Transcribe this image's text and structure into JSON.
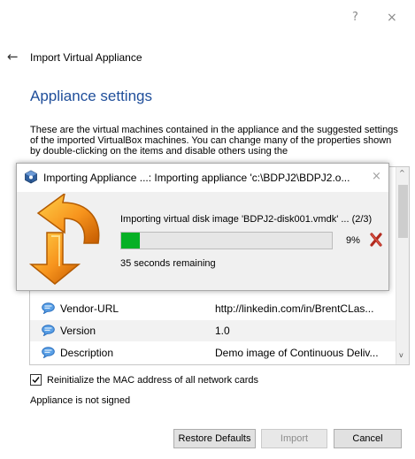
{
  "window": {
    "help_glyph": "?",
    "close_glyph": "×"
  },
  "wizard": {
    "back_glyph": "←",
    "title": "Import Virtual Appliance",
    "section_title": "Appliance settings",
    "description": "These are the virtual machines contained in the appliance and the suggested settings of the imported VirtualBox machines. You can change many of the properties shown by double-clicking on the items and disable others using the"
  },
  "properties": {
    "rows": [
      {
        "key": "Vendor-URL",
        "value": "http://linkedin.com/in/BrentCLas..."
      },
      {
        "key": "Version",
        "value": "1.0"
      },
      {
        "key": "Description",
        "value": "Demo image of Continuous Deliv..."
      }
    ],
    "icon": "comment-bubble-icon",
    "scroll_up_glyph": "^",
    "scroll_down_glyph": "v"
  },
  "progress_dialog": {
    "title": "Importing Appliance ...: Importing appliance 'c:\\BDPJ2\\BDPJ2.o...",
    "close_glyph": "×",
    "status": "Importing virtual disk image 'BDPJ2-disk001.vmdk' ... (2/3)",
    "percent_text": "9%",
    "progress_fraction": 0.09,
    "remaining": "35 seconds remaining",
    "bar_color": "#06b025",
    "logo": "virtualbox-import-arrow-icon",
    "cancel_icon": "red-x-cancel-icon"
  },
  "options": {
    "mac_checkbox_checked": true,
    "mac_label": "Reinitialize the MAC address of all network cards",
    "signed_status": "Appliance is not signed"
  },
  "buttons": {
    "restore_defaults": "Restore Defaults",
    "import": "Import",
    "cancel": "Cancel"
  },
  "colors": {
    "section_title": "#1f4e9a",
    "progress_fill": "#06b025"
  }
}
